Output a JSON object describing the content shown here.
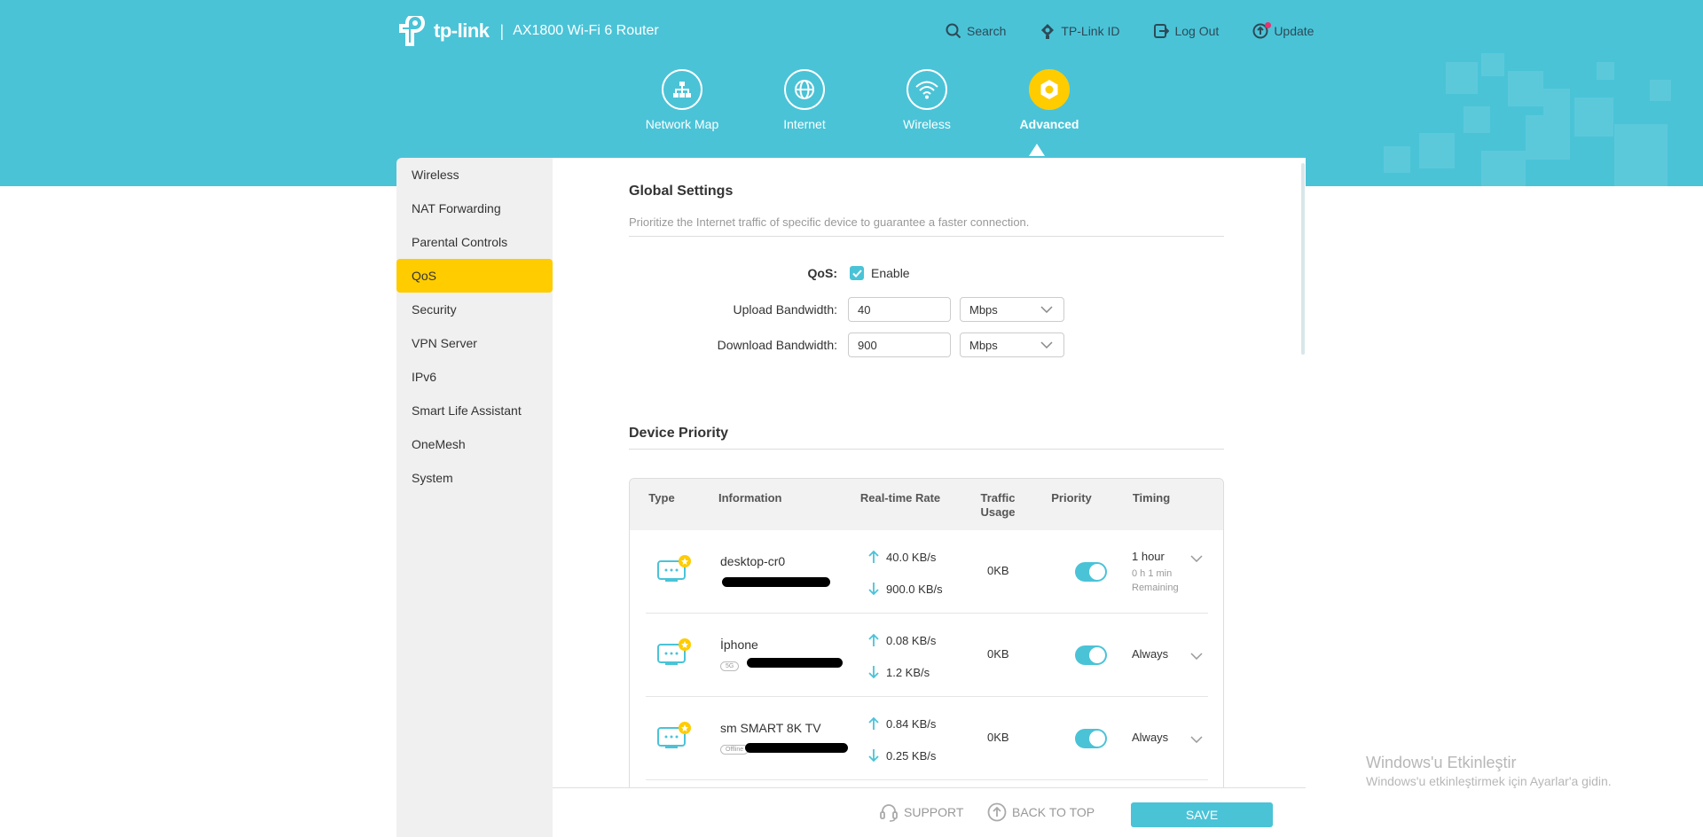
{
  "brand": {
    "logo_text": "tp-link",
    "separator": "|",
    "model": "AX1800 Wi-Fi 6 Router"
  },
  "top_links": [
    {
      "label": "Search",
      "icon": "search-icon"
    },
    {
      "label": "TP-Link ID",
      "icon": "tplink-id-icon"
    },
    {
      "label": "Log Out",
      "icon": "logout-icon"
    },
    {
      "label": "Update",
      "icon": "update-icon"
    }
  ],
  "main_nav": [
    {
      "label": "Network Map",
      "icon": "network-map-icon"
    },
    {
      "label": "Internet",
      "icon": "globe-icon"
    },
    {
      "label": "Wireless",
      "icon": "wifi-icon"
    },
    {
      "label": "Advanced",
      "icon": "gear-icon",
      "active": true
    }
  ],
  "sidebar": {
    "items": [
      {
        "label": "Wireless"
      },
      {
        "label": "NAT Forwarding"
      },
      {
        "label": "Parental Controls"
      },
      {
        "label": "QoS",
        "active": true
      },
      {
        "label": "Security"
      },
      {
        "label": "VPN Server"
      },
      {
        "label": "IPv6"
      },
      {
        "label": "Smart Life Assistant"
      },
      {
        "label": "OneMesh"
      },
      {
        "label": "System"
      }
    ]
  },
  "global": {
    "title": "Global Settings",
    "description": "Prioritize the Internet traffic of specific device to guarantee a faster connection.",
    "qos_label": "QoS:",
    "enable_label": "Enable",
    "enable_checked": true,
    "upload_label": "Upload Bandwidth:",
    "upload_value": "40",
    "upload_unit": "Mbps",
    "download_label": "Download Bandwidth:",
    "download_value": "900",
    "download_unit": "Mbps"
  },
  "priority": {
    "title": "Device Priority",
    "headers": {
      "type": "Type",
      "information": "Information",
      "rate": "Real-time Rate",
      "traffic": "Traffic Usage",
      "priority": "Priority",
      "timing": "Timing"
    },
    "rows": [
      {
        "name": "desktop-cr0",
        "tag": "",
        "up": "40.0 KB/s",
        "down": "900.0 KB/s",
        "traffic": "0KB",
        "priority_on": true,
        "timing": "1 hour",
        "timing_sub1": "0 h 1 min",
        "timing_sub2": "Remaining"
      },
      {
        "name": "İphone",
        "tag": "5G",
        "up": "0.08 KB/s",
        "down": "1.2 KB/s",
        "traffic": "0KB",
        "priority_on": true,
        "timing": "Always",
        "timing_sub1": "",
        "timing_sub2": ""
      },
      {
        "name": "sm SMART 8K TV",
        "tag": "Offline",
        "up": "0.84 KB/s",
        "down": "0.25 KB/s",
        "traffic": "0KB",
        "priority_on": true,
        "timing": "Always",
        "timing_sub1": "",
        "timing_sub2": ""
      }
    ]
  },
  "footer": {
    "support": "SUPPORT",
    "back_to_top": "BACK TO TOP",
    "save": "SAVE"
  },
  "watermark": {
    "title": "Windows'u Etkinleştir",
    "subtitle": "Windows'u etkinleştirmek için Ayarlar'a gidin."
  },
  "colors": {
    "accent": "#4ac3d7",
    "active": "#ffcc00"
  }
}
